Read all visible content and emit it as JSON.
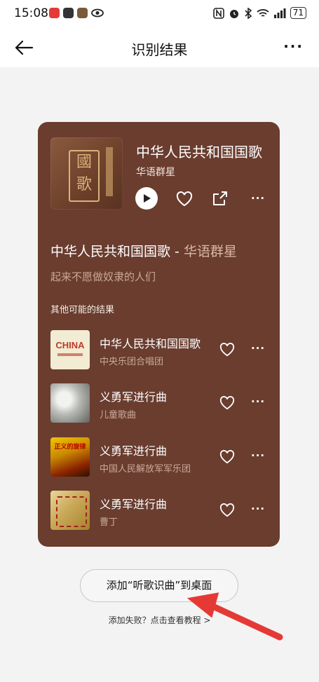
{
  "status_bar": {
    "time": "15:08",
    "battery": "71"
  },
  "header": {
    "title": "识别结果",
    "more": "···"
  },
  "main_result": {
    "title": "中华人民共和国国歌",
    "artist": "华语群星",
    "cover_text": "國歌"
  },
  "lyric": {
    "title_main": "中华人民共和国国歌 - ",
    "title_fade": "华语群星",
    "line": "起来不愿做奴隶的人们"
  },
  "others": {
    "label": "其他可能的结果",
    "items": [
      {
        "title": "中华人民共和国国歌",
        "subtitle": "中央乐团合唱团",
        "thumb_text": "CHINA"
      },
      {
        "title": "义勇军进行曲",
        "subtitle": "儿童歌曲",
        "thumb_text": ""
      },
      {
        "title": "义勇军进行曲",
        "subtitle": "中国人民解放军军乐团",
        "thumb_text": "正义的旋律"
      },
      {
        "title": "义勇军进行曲",
        "subtitle": "曹丁",
        "thumb_text": ""
      }
    ]
  },
  "actions": {
    "add_to_desktop": "添加“听歌识曲”到桌面",
    "fail_hint": "添加失败？点击查看教程 >"
  },
  "colors": {
    "card_bg": "#6a3d2f",
    "arrow": "#e53935"
  }
}
